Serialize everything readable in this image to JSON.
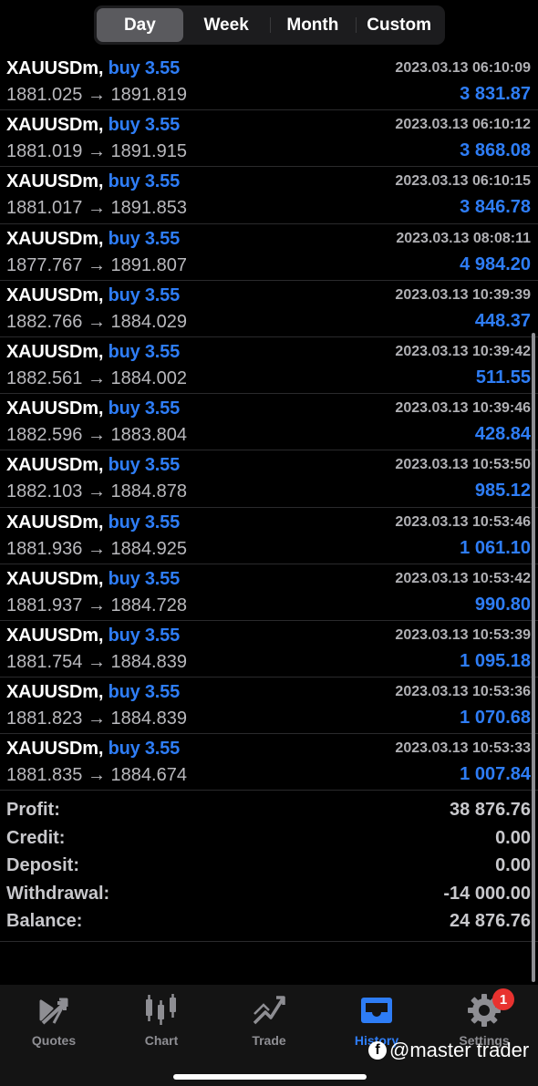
{
  "segments": [
    {
      "label": "Day",
      "active": true
    },
    {
      "label": "Week",
      "active": false
    },
    {
      "label": "Month",
      "active": false
    },
    {
      "label": "Custom",
      "active": false
    }
  ],
  "trades": [
    {
      "symbol": "XAUUSDm,",
      "side": "buy 3.55",
      "time": "2023.03.13 06:10:09",
      "open": "1881.025",
      "close": "1891.819",
      "profit": "3 831.87"
    },
    {
      "symbol": "XAUUSDm,",
      "side": "buy 3.55",
      "time": "2023.03.13 06:10:12",
      "open": "1881.019",
      "close": "1891.915",
      "profit": "3 868.08"
    },
    {
      "symbol": "XAUUSDm,",
      "side": "buy 3.55",
      "time": "2023.03.13 06:10:15",
      "open": "1881.017",
      "close": "1891.853",
      "profit": "3 846.78"
    },
    {
      "symbol": "XAUUSDm,",
      "side": "buy 3.55",
      "time": "2023.03.13 08:08:11",
      "open": "1877.767",
      "close": "1891.807",
      "profit": "4 984.20"
    },
    {
      "symbol": "XAUUSDm,",
      "side": "buy 3.55",
      "time": "2023.03.13 10:39:39",
      "open": "1882.766",
      "close": "1884.029",
      "profit": "448.37"
    },
    {
      "symbol": "XAUUSDm,",
      "side": "buy 3.55",
      "time": "2023.03.13 10:39:42",
      "open": "1882.561",
      "close": "1884.002",
      "profit": "511.55"
    },
    {
      "symbol": "XAUUSDm,",
      "side": "buy 3.55",
      "time": "2023.03.13 10:39:46",
      "open": "1882.596",
      "close": "1883.804",
      "profit": "428.84"
    },
    {
      "symbol": "XAUUSDm,",
      "side": "buy 3.55",
      "time": "2023.03.13 10:53:50",
      "open": "1882.103",
      "close": "1884.878",
      "profit": "985.12"
    },
    {
      "symbol": "XAUUSDm,",
      "side": "buy 3.55",
      "time": "2023.03.13 10:53:46",
      "open": "1881.936",
      "close": "1884.925",
      "profit": "1 061.10"
    },
    {
      "symbol": "XAUUSDm,",
      "side": "buy 3.55",
      "time": "2023.03.13 10:53:42",
      "open": "1881.937",
      "close": "1884.728",
      "profit": "990.80"
    },
    {
      "symbol": "XAUUSDm,",
      "side": "buy 3.55",
      "time": "2023.03.13 10:53:39",
      "open": "1881.754",
      "close": "1884.839",
      "profit": "1 095.18"
    },
    {
      "symbol": "XAUUSDm,",
      "side": "buy 3.55",
      "time": "2023.03.13 10:53:36",
      "open": "1881.823",
      "close": "1884.839",
      "profit": "1 070.68"
    },
    {
      "symbol": "XAUUSDm,",
      "side": "buy 3.55",
      "time": "2023.03.13 10:53:33",
      "open": "1881.835",
      "close": "1884.674",
      "profit": "1 007.84"
    }
  ],
  "arrow": "→",
  "summary": [
    {
      "label": "Profit:",
      "value": "38 876.76"
    },
    {
      "label": "Credit:",
      "value": "0.00"
    },
    {
      "label": "Deposit:",
      "value": "0.00"
    },
    {
      "label": "Withdrawal:",
      "value": "-14 000.00"
    },
    {
      "label": "Balance:",
      "value": "24 876.76"
    }
  ],
  "tabs": [
    {
      "label": "Quotes",
      "icon": "quotes-icon",
      "active": false
    },
    {
      "label": "Chart",
      "icon": "chart-icon",
      "active": false
    },
    {
      "label": "Trade",
      "icon": "trade-icon",
      "active": false
    },
    {
      "label": "History",
      "icon": "history-icon",
      "active": true
    },
    {
      "label": "Settings",
      "icon": "settings-icon",
      "active": false,
      "badge": "1"
    }
  ],
  "watermark": {
    "text": "@master trader",
    "icon": "facebook-icon"
  },
  "colors": {
    "accent": "#2e7df6",
    "badge": "#e8322f"
  }
}
